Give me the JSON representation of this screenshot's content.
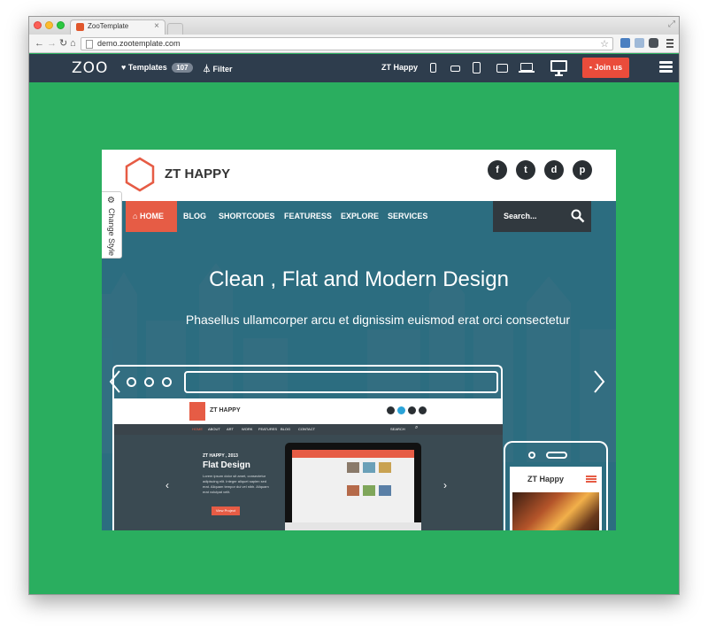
{
  "browser": {
    "tab_title": "ZooTemplate",
    "url": "demo.zootemplate.com"
  },
  "zoobar": {
    "logo": "ZOO",
    "templates_label": "Templates",
    "templates_count": "107",
    "filter_label": "Filter",
    "current_template": "ZT Happy",
    "join_label": "Join us"
  },
  "site": {
    "name": "ZT HAPPY",
    "nav": [
      "HOME",
      "BLOG",
      "SHORTCODES",
      "FEATURESS",
      "EXPLORE",
      "SERVICES"
    ],
    "search_placeholder": "Search...",
    "change_style": "Change Style",
    "social": [
      "f",
      "t",
      "d",
      "p"
    ]
  },
  "hero": {
    "title": "Clean , Flat and Modern Design",
    "subtitle": "Phasellus ullamcorper arcu et dignissim euismod erat orci consectetur"
  },
  "mockup": {
    "name": "ZT HAPPY",
    "nav": [
      "HOME",
      "ABOUT",
      "ART",
      "WORK",
      "FEATURES",
      "BLOG",
      "CONTACT"
    ],
    "search": "SEARCH",
    "kicker": "ZT HAPPY , 2013",
    "title": "Flat Design",
    "text": "Lorem ipsum dolor sit amet, consectetur adipiscing elit. Integer aliquet sapien sed erat. Aliquam tempor dui vel nibh. Aliquam erat volutpat velit.",
    "button": "View Project",
    "phone_title": "ZT Happy"
  },
  "colors": {
    "page_bg": "#2aae5f",
    "zoobar_bg": "#2e3d4d",
    "accent": "#e65c45",
    "site_nav": "#2c6d80"
  }
}
